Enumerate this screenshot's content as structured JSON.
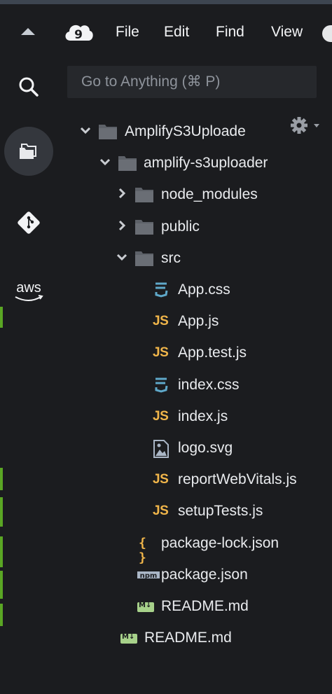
{
  "menu": {
    "items": [
      "File",
      "Edit",
      "Find",
      "View"
    ]
  },
  "search": {
    "placeholder": "Go to Anything (⌘ P)"
  },
  "activity": {
    "aws_label": "aws"
  },
  "tree": {
    "items": [
      {
        "label": "AmplifyS3Uploade",
        "type": "folder",
        "expanded": true,
        "depth": 0
      },
      {
        "label": "amplify-s3uploader",
        "type": "folder",
        "expanded": true,
        "depth": 1
      },
      {
        "label": "node_modules",
        "type": "folder",
        "expanded": false,
        "depth": 2
      },
      {
        "label": "public",
        "type": "folder",
        "expanded": false,
        "depth": 2
      },
      {
        "label": "src",
        "type": "folder",
        "expanded": true,
        "depth": 2
      },
      {
        "label": "App.css",
        "type": "css",
        "depth": 3
      },
      {
        "label": "App.js",
        "type": "js",
        "depth": 3
      },
      {
        "label": "App.test.js",
        "type": "js",
        "depth": 3
      },
      {
        "label": "index.css",
        "type": "css",
        "depth": 3
      },
      {
        "label": "index.js",
        "type": "js",
        "depth": 3
      },
      {
        "label": "logo.svg",
        "type": "image",
        "depth": 3
      },
      {
        "label": "reportWebVitals.js",
        "type": "js",
        "depth": 3
      },
      {
        "label": "setupTests.js",
        "type": "js",
        "depth": 3
      },
      {
        "label": "package-lock.json",
        "type": "json",
        "depth": 2
      },
      {
        "label": "package.json",
        "type": "npm",
        "depth": 2
      },
      {
        "label": "README.md",
        "type": "md",
        "depth": 2
      },
      {
        "label": "README.md",
        "type": "md",
        "depth": 1
      }
    ]
  },
  "icons": {
    "js_badge": "JS",
    "json_badge": "{ }",
    "md_badge": "M↓",
    "npm_badge": "npm",
    "cloud_badge": "9"
  },
  "colors": {
    "background": "#1b1c1f",
    "folder": "#5d6168",
    "js": "#f0b54a",
    "css": "#5fa8c9",
    "md": "#a7d18a",
    "active_circle": "#34373d"
  }
}
